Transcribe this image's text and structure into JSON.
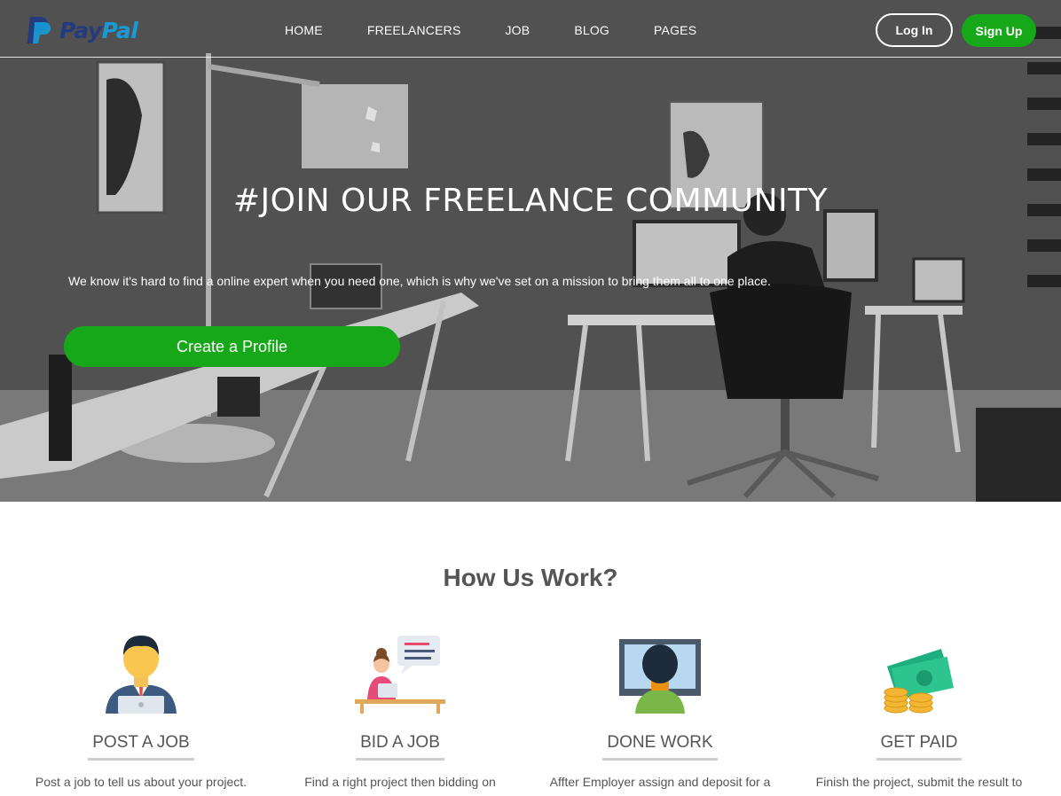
{
  "brand": {
    "logo_part1": "Pay",
    "logo_part2": "Pal"
  },
  "nav": {
    "items": [
      "HOME",
      "FREELANCERS",
      "JOB",
      "BLOG",
      "PAGES"
    ],
    "login_label": "Log In",
    "signup_label": "Sign Up"
  },
  "hero": {
    "title": "#JOIN OUR FREELANCE COMMUNITY",
    "subtitle": "We know it's hard to find a online expert when you need one, which is why we've set on a mission to bring them all to one place.",
    "cta_label": "Create a Profile"
  },
  "how": {
    "title": "How Us Work?",
    "steps": [
      {
        "label": "POST A JOB",
        "desc": "Post a job to tell us about your project.",
        "icon": "businessman-laptop-icon"
      },
      {
        "label": "BID A JOB",
        "desc": "Find a right project then bidding on",
        "icon": "woman-chat-desk-icon"
      },
      {
        "label": "DONE WORK",
        "desc": "Affter Employer assign and deposit for a",
        "icon": "worker-monitor-icon"
      },
      {
        "label": "GET PAID",
        "desc": "Finish the project, submit the result to",
        "icon": "money-coins-icon"
      }
    ]
  },
  "colors": {
    "accent_green": "#17a81a",
    "brand_dark_blue": "#253b80",
    "brand_light_blue": "#179bd7"
  }
}
